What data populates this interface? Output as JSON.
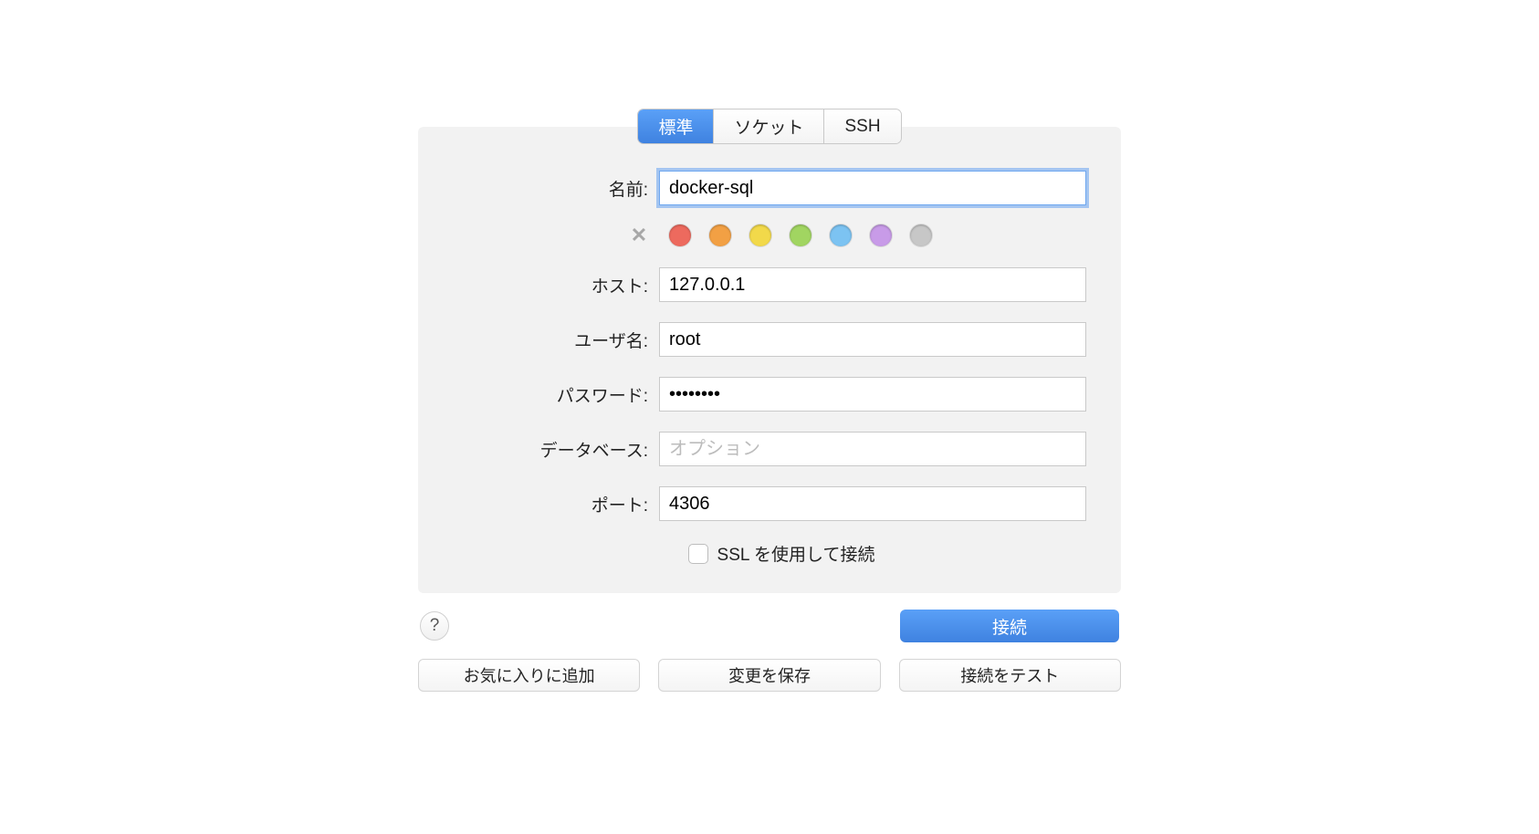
{
  "tabs": {
    "standard": "標準",
    "socket": "ソケット",
    "ssh": "SSH"
  },
  "labels": {
    "name": "名前:",
    "host": "ホスト:",
    "username": "ユーザ名:",
    "password": "パスワード:",
    "database": "データベース:",
    "port": "ポート:",
    "ssl": "SSL を使用して接続"
  },
  "values": {
    "name": "docker-sql",
    "host": "127.0.0.1",
    "username": "root",
    "password": "••••••••",
    "database_placeholder": "オプション",
    "port": "4306"
  },
  "colors": {
    "red": "#ed6a5e",
    "orange": "#f2a044",
    "yellow": "#f2d94a",
    "green": "#a1d561",
    "blue": "#7cc3f2",
    "purple": "#c89be8",
    "gray": "#c7c7c7"
  },
  "buttons": {
    "help": "?",
    "connect": "接続",
    "addFavorite": "お気に入りに追加",
    "saveChanges": "変更を保存",
    "testConnection": "接続をテスト"
  }
}
